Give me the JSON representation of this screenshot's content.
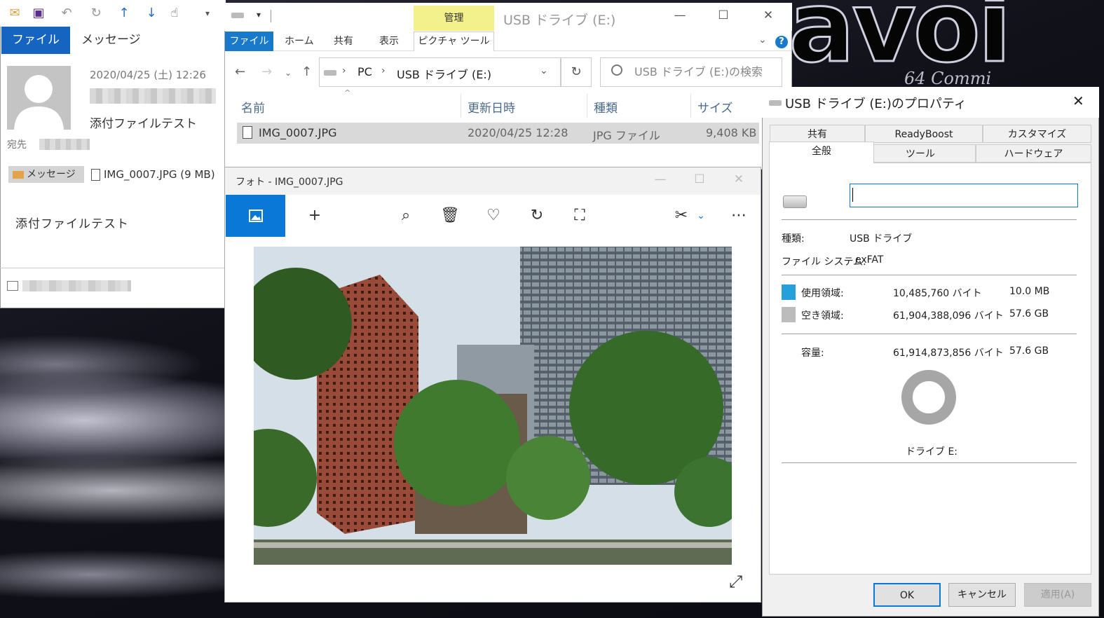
{
  "mail": {
    "file_tab": "ファイル",
    "message_tab": "メッセージ",
    "date": "2020/04/25 (土) 12:26",
    "subject": "添付ファイルテスト",
    "to_label": "宛先",
    "attachment_message": "メッセージ",
    "attachment_file": "IMG_0007.JPG (9 MB)",
    "body": "添付ファイルテスト"
  },
  "explorer": {
    "manage_label": "管理",
    "title": "USB ドライブ (E:)",
    "tabs": {
      "file": "ファイル",
      "home": "ホーム",
      "share": "共有",
      "view": "表示",
      "picture_tools": "ピクチャ ツール"
    },
    "breadcrumb": [
      "PC",
      "USB ドライブ (E:)"
    ],
    "search_placeholder": "USB ドライブ (E:)の検索",
    "columns": {
      "name": "名前",
      "modified": "更新日時",
      "type": "種類",
      "size": "サイズ"
    },
    "rows": [
      {
        "name": "IMG_0007.JPG",
        "modified": "2020/04/25 12:28",
        "type": "JPG ファイル",
        "size": "9,408 KB"
      }
    ]
  },
  "photos": {
    "title": "フォト - IMG_0007.JPG"
  },
  "properties": {
    "title": "USB ドライブ (E:)のプロパティ",
    "tabs_top": [
      "共有",
      "ReadyBoost",
      "カスタマイズ"
    ],
    "tabs_bottom": [
      "全般",
      "ツール",
      "ハードウェア"
    ],
    "name_value": "",
    "type_label": "種類:",
    "type_value": "USB ドライブ",
    "fs_label": "ファイル システム:",
    "fs_value": "exFAT",
    "used_label": "使用領域:",
    "used_bytes": "10,485,760 バイト",
    "used_human": "10.0 MB",
    "free_label": "空き領域:",
    "free_bytes": "61,904,388,096 バイト",
    "free_human": "57.6 GB",
    "capacity_label": "容量:",
    "capacity_bytes": "61,914,873,856 バイト",
    "capacity_human": "57.6 GB",
    "drive_label": "ドライブ E:",
    "buttons": {
      "ok": "OK",
      "cancel": "キャンセル",
      "apply": "適用(A)"
    },
    "colors": {
      "used": "#26a0da",
      "free": "#bcbcbc"
    }
  },
  "wallpaper": {
    "logo": "avoi",
    "sub": "64 Commi"
  }
}
